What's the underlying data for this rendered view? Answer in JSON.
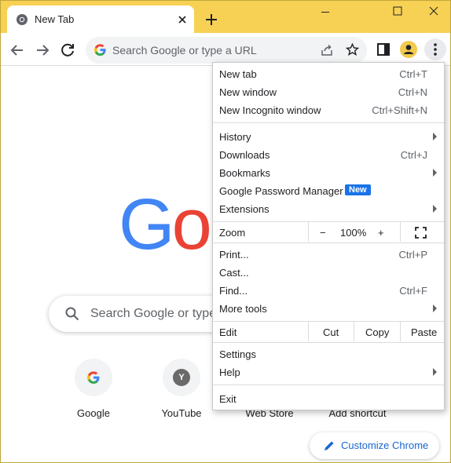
{
  "tab": {
    "title": "New Tab"
  },
  "omnibox": {
    "placeholder": "Search Google or type a URL"
  },
  "page": {
    "logo_letters": [
      "G",
      "o"
    ],
    "search_placeholder": "Search Google or type",
    "shortcuts": [
      {
        "label": "Google",
        "initial": "G"
      },
      {
        "label": "YouTube",
        "initial": "Y"
      },
      {
        "label": "Web Store",
        "initial": ""
      },
      {
        "label": "Add shortcut",
        "initial": ""
      }
    ],
    "customize_label": "Customize Chrome"
  },
  "menu": {
    "new_tab": {
      "label": "New tab",
      "shortcut": "Ctrl+T"
    },
    "new_window": {
      "label": "New window",
      "shortcut": "Ctrl+N"
    },
    "new_incognito": {
      "label": "New Incognito window",
      "shortcut": "Ctrl+Shift+N"
    },
    "history": {
      "label": "History"
    },
    "downloads": {
      "label": "Downloads",
      "shortcut": "Ctrl+J"
    },
    "bookmarks": {
      "label": "Bookmarks"
    },
    "password_manager": {
      "label": "Google Password Manager",
      "badge": "New"
    },
    "extensions": {
      "label": "Extensions"
    },
    "zoom": {
      "label": "Zoom",
      "minus": "−",
      "level": "100%",
      "plus": "+"
    },
    "print": {
      "label": "Print...",
      "shortcut": "Ctrl+P"
    },
    "cast": {
      "label": "Cast..."
    },
    "find": {
      "label": "Find...",
      "shortcut": "Ctrl+F"
    },
    "more_tools": {
      "label": "More tools"
    },
    "edit": {
      "label": "Edit",
      "cut": "Cut",
      "copy": "Copy",
      "paste": "Paste"
    },
    "settings": {
      "label": "Settings"
    },
    "help": {
      "label": "Help"
    },
    "exit": {
      "label": "Exit"
    }
  },
  "colors": {
    "titlebar": "#f7d154",
    "accent_blue": "#1a73e8",
    "google_blue": "#4285f4",
    "google_red": "#ea4335"
  }
}
